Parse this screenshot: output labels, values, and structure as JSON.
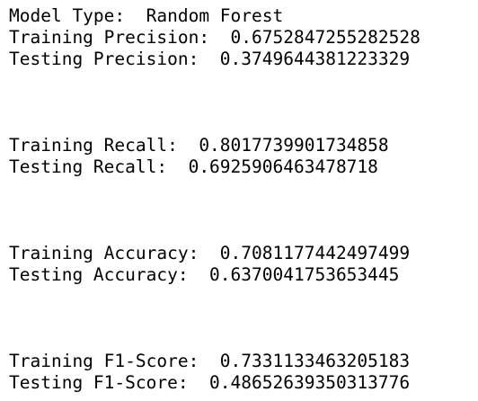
{
  "output": {
    "model_line": "Model Type:  Random Forest",
    "precision": {
      "training": "Training Precision:  0.6752847255282528",
      "testing": "Testing Precision:  0.3749644381223329"
    },
    "recall": {
      "training": "Training Recall:  0.8017739901734858",
      "testing": "Testing Recall:  0.6925906463478718"
    },
    "accuracy": {
      "training": "Training Accuracy:  0.7081177442497499",
      "testing": "Testing Accuracy:  0.6370041753653445"
    },
    "f1": {
      "training": "Training F1-Score:  0.7331133463205183",
      "testing": "Testing F1-Score:  0.48652639350313776"
    }
  }
}
